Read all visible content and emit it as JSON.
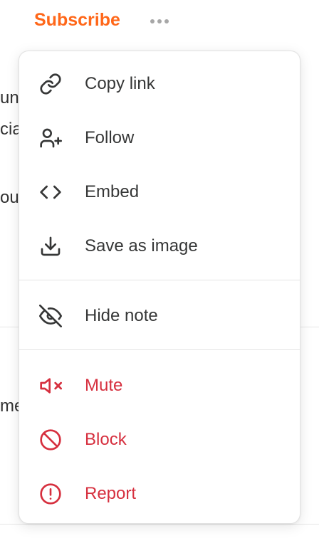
{
  "header": {
    "subscribe_label": "Subscribe",
    "more_icon": "ellipsis-icon"
  },
  "background": {
    "fragments": [
      "un",
      "cia",
      "ou",
      "me"
    ]
  },
  "menu": {
    "items": [
      {
        "label": "Copy link",
        "icon": "link-icon"
      },
      {
        "label": "Follow",
        "icon": "user-plus-icon"
      },
      {
        "label": "Embed",
        "icon": "code-icon"
      },
      {
        "label": "Save as image",
        "icon": "download-icon"
      },
      {
        "label": "Hide note",
        "icon": "eye-off-icon"
      },
      {
        "label": "Mute",
        "icon": "volume-mute-icon"
      },
      {
        "label": "Block",
        "icon": "block-icon"
      },
      {
        "label": "Report",
        "icon": "alert-icon"
      }
    ]
  },
  "colors": {
    "accent": "#ff6719",
    "danger": "#d62f3e",
    "text": "#363737"
  }
}
